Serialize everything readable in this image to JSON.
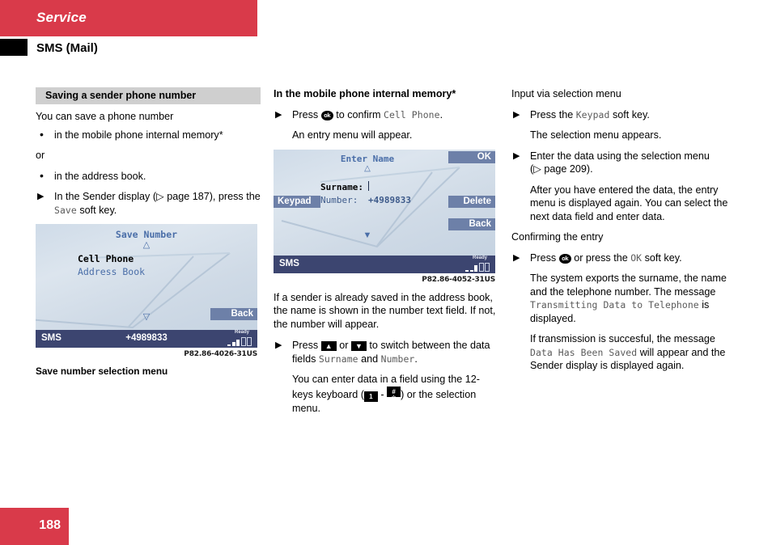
{
  "header": {
    "section": "Service",
    "subsection": "SMS (Mail)"
  },
  "colors": {
    "brand_red": "#d93a4a",
    "heading_grey": "#cfcfcf",
    "display_softkey": "#6d80a8",
    "display_statusbar": "#3c4570",
    "display_accent_blue": "#4a6ea8"
  },
  "footer": {
    "page_number": "188"
  },
  "column1": {
    "heading": "Saving a sender phone number",
    "intro": "You can save a phone number",
    "bullet1": "in the mobile phone internal memory*",
    "or": "or",
    "bullet2": "in the address book.",
    "step1_a": "In the Sender display (",
    "step1_pageref": "page 187",
    "step1_b": "), press the ",
    "step1_mono": "Save",
    "step1_c": " soft key.",
    "figure": {
      "title": "Save Number",
      "up_arrow": "△",
      "option1": "Cell Phone",
      "option2": "Address Book",
      "down_arrow": "▽",
      "softkey_back": "Back",
      "status_label": "SMS",
      "status_number": "+4989833",
      "status_ready": "Ready",
      "image_code": "P82.86-4026-31US"
    },
    "caption": "Save number selection menu"
  },
  "column2": {
    "heading": "In the mobile phone internal memory*",
    "step1_a": "Press ",
    "step1_key": "ok",
    "step1_b": " to confirm ",
    "step1_mono": "Cell Phone",
    "step1_c": ".",
    "step1_note": "An entry menu will appear.",
    "figure": {
      "title": "Enter Name",
      "up_arrow": "△",
      "label_surname": "Surname:",
      "value_surname": "",
      "label_number": "Number:",
      "value_number": "+4989833",
      "down_arrow": "▼",
      "softkey_ok": "OK",
      "softkey_keypad": "Keypad",
      "softkey_delete": "Delete",
      "softkey_back": "Back",
      "status_label": "SMS",
      "status_ready": "Ready",
      "image_code": "P82.86-4052-31US"
    },
    "para1": "If a sender is already saved in the address book, the name is shown in the number text field. If not, the number will appear.",
    "step2_a": "Press ",
    "step2_key_up": "▲",
    "step2_mid": " or ",
    "step2_key_down": "▼",
    "step2_b": " to switch between the data fields ",
    "step2_mono1": "Surname",
    "step2_c": " and ",
    "step2_mono2": "Number",
    "step2_d": ".",
    "step2_note_a": "You can enter data in a field using the 12-keys keyboard (",
    "step2_note_key1": "1",
    "step2_note_key2_top": "#",
    "step2_note_key2_bot": "☆",
    "step2_note_b": ") or the selection menu."
  },
  "column3": {
    "heading1": "Input via selection menu",
    "step1_a": "Press the ",
    "step1_mono": "Keypad",
    "step1_b": " soft key.",
    "step1_note": "The selection menu appears.",
    "step2_a": "Enter the data using the selection menu (",
    "step2_pageref": "page 209",
    "step2_b": ").",
    "step2_note": "After you have entered the data, the entry menu is displayed again. You can select the next data field and enter data.",
    "heading2": "Confirming the entry",
    "step3_a": "Press ",
    "step3_key": "ok",
    "step3_b": " or press the ",
    "step3_mono": "OK",
    "step3_c": " soft key.",
    "step3_note_a": "The system exports the surname, the name and the telephone number. The message ",
    "step3_note_mono": "Transmitting Data to Telephone",
    "step3_note_b": " is displayed.",
    "step4_note_a": "If transmission is succesful, the message ",
    "step4_note_mono": "Data Has Been Saved",
    "step4_note_b": " will appear and the Sender display is displayed again."
  }
}
